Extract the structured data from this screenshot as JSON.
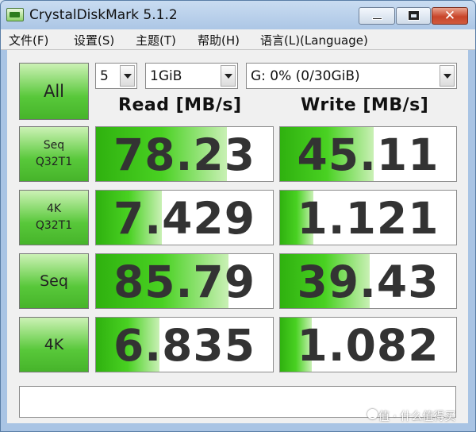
{
  "window": {
    "title": "CrystalDiskMark 5.1.2",
    "close_glyph": "✕"
  },
  "menu": [
    "文件(F)",
    "设置(S)",
    "主题(T)",
    "帮助(H)",
    "语言(L)(Language)"
  ],
  "controls": {
    "all_label": "All",
    "count": "5",
    "size": "1GiB",
    "drive": "G: 0% (0/30GiB)"
  },
  "headers": {
    "read": "Read [MB/s]",
    "write": "Write [MB/s]"
  },
  "rows": [
    {
      "line1": "Seq",
      "line2": "Q32T1",
      "read": "78.23",
      "write": "45.11",
      "read_fill": 0.74,
      "write_fill": 0.53
    },
    {
      "line1": "4K",
      "line2": "Q32T1",
      "read": "7.429",
      "write": "1.121",
      "read_fill": 0.37,
      "write_fill": 0.19
    },
    {
      "line1": "Seq",
      "line2": "",
      "read": "85.79",
      "write": "39.43",
      "read_fill": 0.75,
      "write_fill": 0.51
    },
    {
      "line1": "4K",
      "line2": "",
      "read": "6.835",
      "write": "1.082",
      "read_fill": 0.36,
      "write_fill": 0.18
    }
  ],
  "status_text": "",
  "watermark": "值 · 什么值得买",
  "colors": {
    "bar_green": "#49d122",
    "button_green": "#58c83a"
  }
}
